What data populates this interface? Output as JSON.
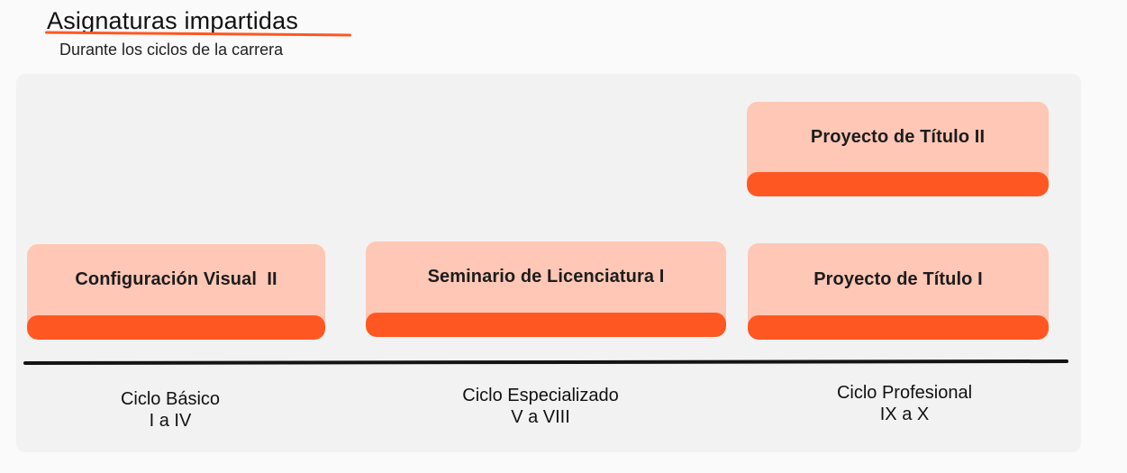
{
  "header": {
    "title": "Asignaturas impartidas",
    "subtitle": "Durante los ciclos de la carrera"
  },
  "colors": {
    "accent": "#ff5722",
    "card_fill": "#ffc7b5",
    "panel": "#f2f2f2",
    "timeline": "#141414"
  },
  "courses": [
    {
      "name": "Configuración Visual  II",
      "cycle": "Ciclo Básico"
    },
    {
      "name": "Seminario de Licenciatura I",
      "cycle": "Ciclo Especializado"
    },
    {
      "name": "Proyecto de Título I",
      "cycle": "Ciclo Profesional"
    },
    {
      "name": "Proyecto de Título II",
      "cycle": "Ciclo Profesional"
    }
  ],
  "cycles": [
    {
      "name": "Ciclo Básico",
      "range": "I a IV"
    },
    {
      "name": "Ciclo Especializado",
      "range": "V a VIII"
    },
    {
      "name": "Ciclo Profesional",
      "range": "IX a X"
    }
  ]
}
